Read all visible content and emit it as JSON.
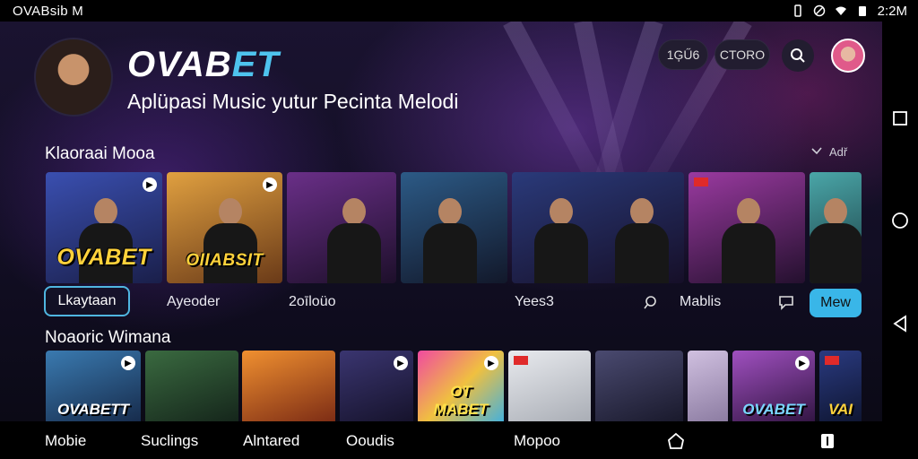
{
  "status_bar": {
    "carrier": "OVABsib M",
    "time": "2:2M"
  },
  "header": {
    "logo_main": "OVAB",
    "logo_accent": "ET",
    "tagline": "Aplüpasi Music yutur Pecinta Melodi",
    "pill_1": "1ĢŰ6",
    "pill_2": "CTORO"
  },
  "section1": {
    "title": "Klaoraai Mooa",
    "more": "Adř",
    "cards": [
      {
        "label": "OVABET",
        "bg": "#2e3f8a"
      },
      {
        "label": "OIIABSIT",
        "bg": "#b9762f"
      },
      {
        "label": "",
        "bg": "#5a2a70"
      },
      {
        "label": "",
        "bg": "#1f3550"
      },
      {
        "label": "",
        "bg": "#2a2f55"
      },
      {
        "label": "",
        "bg": "#5a2b6e"
      },
      {
        "label": "",
        "bg": "#2d5a6a"
      }
    ],
    "row_labels": {
      "selected": "Lkaytaan",
      "a": "Ayeoder",
      "b": "2oīloüo",
      "c": "Yees3",
      "d": "Mablis",
      "menu": "Mew"
    }
  },
  "section2": {
    "title": "Noaoric Wimana",
    "cards": [
      {
        "label": "OVABETT",
        "bg": "#2a5b8a"
      },
      {
        "label": "",
        "bg": "#2c4d30"
      },
      {
        "label": "",
        "bg": "#c86a22"
      },
      {
        "label": "",
        "bg": "#2b2750"
      },
      {
        "label": "OT MABET",
        "bg": "#c03a8a"
      },
      {
        "label": "",
        "bg": "#cfd2d8"
      },
      {
        "label": "",
        "bg": "#3a3a56"
      },
      {
        "label": "",
        "bg": "#b7a6c8"
      },
      {
        "label": "OVABET",
        "bg": "#7a3a9a"
      },
      {
        "label": "VAI",
        "bg": "#1a2b5a"
      }
    ]
  },
  "tabs": [
    "Mobie",
    "Suclings",
    "Alntared",
    "Ooudis",
    "Mopoo"
  ],
  "colors": {
    "accent": "#39b6e8",
    "label_yellow": "#ffd23b"
  }
}
